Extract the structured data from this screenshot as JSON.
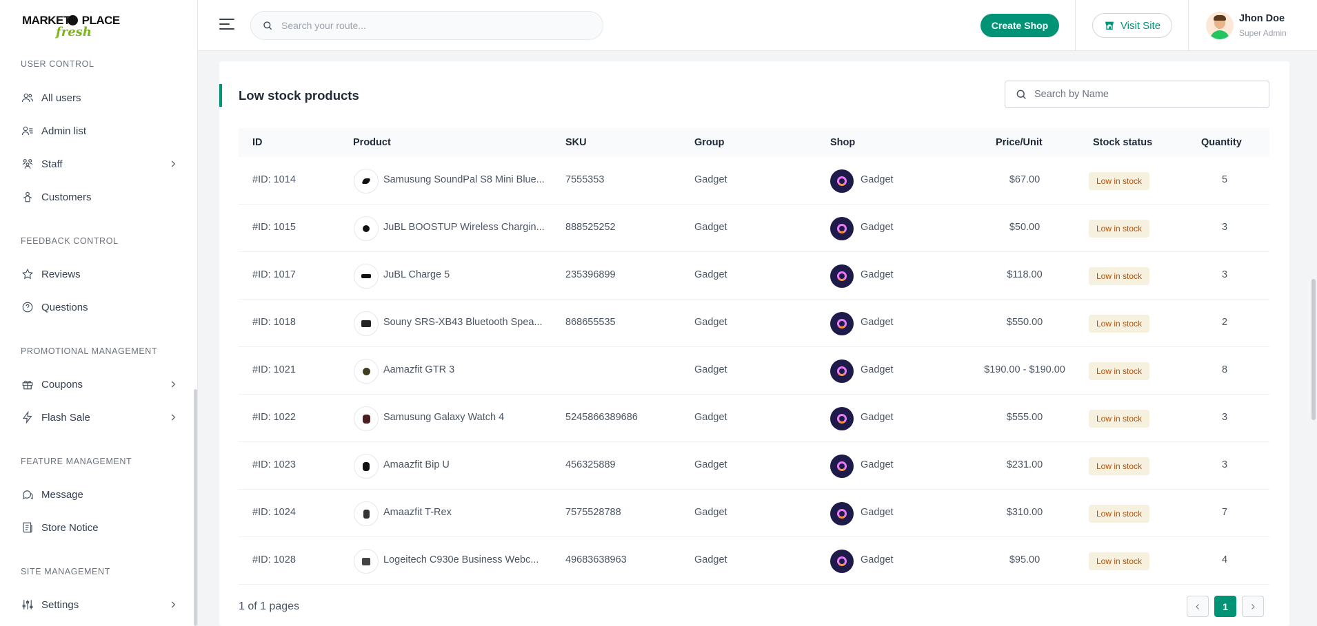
{
  "brand": {
    "line1": "MARKET",
    "line1b": "PLACE",
    "line2": "fresh"
  },
  "sidebar": {
    "sections": [
      {
        "label": "USER CONTROL"
      },
      {
        "label": "FEEDBACK CONTROL"
      },
      {
        "label": "PROMOTIONAL MANAGEMENT"
      },
      {
        "label": "FEATURE MANAGEMENT"
      },
      {
        "label": "SITE MANAGEMENT"
      }
    ],
    "items": [
      {
        "label": "All users",
        "icon": "users-icon"
      },
      {
        "label": "Admin list",
        "icon": "admin-list-icon"
      },
      {
        "label": "Staff",
        "icon": "staff-icon"
      },
      {
        "label": "Customers",
        "icon": "customer-icon"
      },
      {
        "label": "Reviews",
        "icon": "star-icon"
      },
      {
        "label": "Questions",
        "icon": "question-icon"
      },
      {
        "label": "Coupons",
        "icon": "gift-icon"
      },
      {
        "label": "Flash Sale",
        "icon": "lightning-icon"
      },
      {
        "label": "Message",
        "icon": "chat-icon"
      },
      {
        "label": "Store Notice",
        "icon": "notice-icon"
      },
      {
        "label": "Settings",
        "icon": "settings-sliders-icon"
      }
    ]
  },
  "header": {
    "search_placeholder": "Search your route...",
    "create_shop": "Create Shop",
    "visit_site": "Visit Site",
    "user_name": "Jhon Doe",
    "user_role": "Super Admin"
  },
  "card": {
    "title": "Low stock products",
    "search_placeholder": "Search by Name",
    "columns": [
      "ID",
      "Product",
      "SKU",
      "Group",
      "Shop",
      "Price/Unit",
      "Stock status",
      "Quantity"
    ],
    "rows": [
      {
        "id": "#ID: 1014",
        "product": "Samusung SoundPal S8 Mini Blue...",
        "sku": "7555353",
        "group": "Gadget",
        "shop": "Gadget",
        "price": "$67.00",
        "status": "Low in stock",
        "qty": "5"
      },
      {
        "id": "#ID: 1015",
        "product": "JuBL BOOSTUP Wireless Chargin...",
        "sku": "888525252",
        "group": "Gadget",
        "shop": "Gadget",
        "price": "$50.00",
        "status": "Low in stock",
        "qty": "3"
      },
      {
        "id": "#ID: 1017",
        "product": "JuBL Charge 5",
        "sku": "235396899",
        "group": "Gadget",
        "shop": "Gadget",
        "price": "$118.00",
        "status": "Low in stock",
        "qty": "3"
      },
      {
        "id": "#ID: 1018",
        "product": "Souny SRS-XB43 Bluetooth Spea...",
        "sku": "868655535",
        "group": "Gadget",
        "shop": "Gadget",
        "price": "$550.00",
        "status": "Low in stock",
        "qty": "2"
      },
      {
        "id": "#ID: 1021",
        "product": "Aamazfit GTR 3",
        "sku": "",
        "group": "Gadget",
        "shop": "Gadget",
        "price": "$190.00 - $190.00",
        "status": "Low in stock",
        "qty": "8"
      },
      {
        "id": "#ID: 1022",
        "product": "Samusung Galaxy Watch 4",
        "sku": "5245866389686",
        "group": "Gadget",
        "shop": "Gadget",
        "price": "$555.00",
        "status": "Low in stock",
        "qty": "3"
      },
      {
        "id": "#ID: 1023",
        "product": "Amaazfit Bip U",
        "sku": "456325889",
        "group": "Gadget",
        "shop": "Gadget",
        "price": "$231.00",
        "status": "Low in stock",
        "qty": "3"
      },
      {
        "id": "#ID: 1024",
        "product": "Amaazfit T-Rex",
        "sku": "7575528788",
        "group": "Gadget",
        "shop": "Gadget",
        "price": "$310.00",
        "status": "Low in stock",
        "qty": "7"
      },
      {
        "id": "#ID: 1028",
        "product": "Logeitech C930e Business Webc...",
        "sku": "49683638963",
        "group": "Gadget",
        "shop": "Gadget",
        "price": "$95.00",
        "status": "Low in stock",
        "qty": "4"
      }
    ],
    "pagination": {
      "summary": "1 of 1 pages",
      "current": "1"
    }
  },
  "colors": {
    "accent": "#019376",
    "badge_bg": "#f6f0df",
    "badge_text": "#b45309"
  }
}
